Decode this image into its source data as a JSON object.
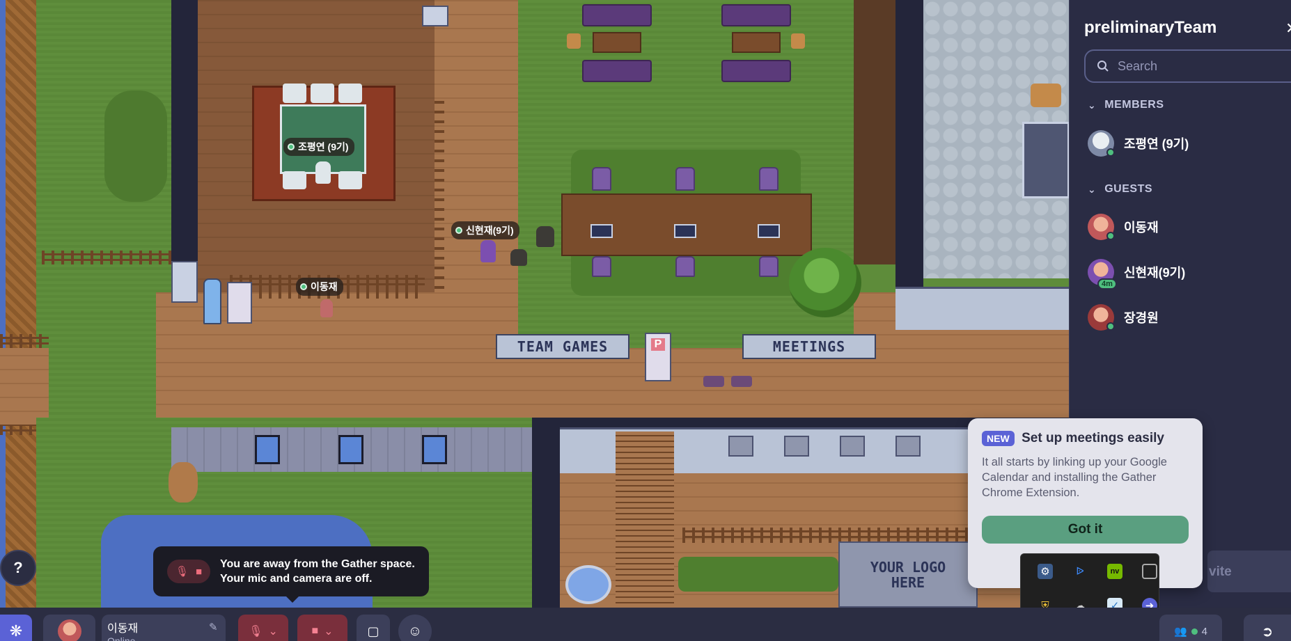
{
  "map": {
    "nametags": [
      "조평연 (9기)",
      "신현재(9기)",
      "이동재"
    ],
    "signs": {
      "team_games": "TEAM GAMES",
      "meetings": "MEETINGS",
      "logo_line1": "YOUR LOGO",
      "logo_line2": "HERE",
      "parking": "P"
    }
  },
  "panel": {
    "title": "preliminaryTeam",
    "close": "✕",
    "search_placeholder": "Search",
    "members_heading": "MEMBERS",
    "guests_heading": "GUESTS",
    "members": [
      {
        "name": "조평연 (9기)"
      }
    ],
    "guests": [
      {
        "name": "이동재"
      },
      {
        "name": "신현재(9기)",
        "badge": "4m"
      },
      {
        "name": "장경원"
      }
    ]
  },
  "meetings_popover": {
    "new_badge": "NEW",
    "title": "Set up meetings easily",
    "body": "It all starts by linking up your Google Calendar and installing the Gather Chrome Extension.",
    "button": "Got it",
    "invite_ghost": "vite"
  },
  "away_toast": {
    "line1": "You are away from the Gather space.",
    "line2": "Your mic and camera are off."
  },
  "help": "?",
  "bottombar": {
    "user_name": "이동재",
    "user_status": "Online",
    "participants_count": "4"
  },
  "colors": {
    "accent": "#5b62d6",
    "online": "#4fbf7f",
    "danger": "#7a2f3c",
    "panel_bg": "#2a2c44"
  }
}
